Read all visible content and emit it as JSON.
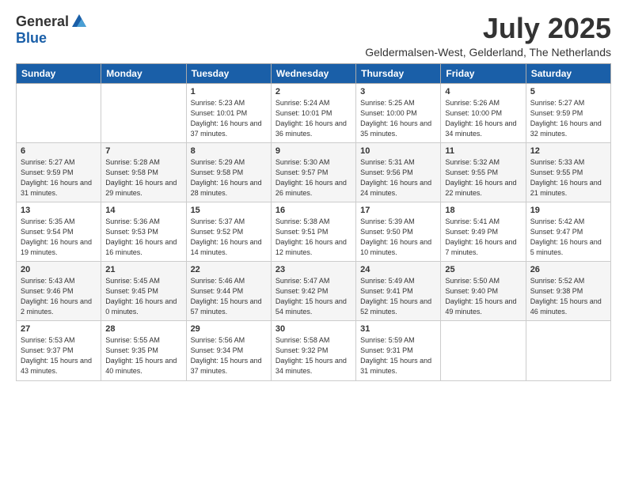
{
  "logo": {
    "general": "General",
    "blue": "Blue"
  },
  "title": "July 2025",
  "subtitle": "Geldermalsen-West, Gelderland, The Netherlands",
  "weekdays": [
    "Sunday",
    "Monday",
    "Tuesday",
    "Wednesday",
    "Thursday",
    "Friday",
    "Saturday"
  ],
  "weeks": [
    [
      {
        "day": "",
        "info": ""
      },
      {
        "day": "",
        "info": ""
      },
      {
        "day": "1",
        "info": "Sunrise: 5:23 AM\nSunset: 10:01 PM\nDaylight: 16 hours\nand 37 minutes."
      },
      {
        "day": "2",
        "info": "Sunrise: 5:24 AM\nSunset: 10:01 PM\nDaylight: 16 hours\nand 36 minutes."
      },
      {
        "day": "3",
        "info": "Sunrise: 5:25 AM\nSunset: 10:00 PM\nDaylight: 16 hours\nand 35 minutes."
      },
      {
        "day": "4",
        "info": "Sunrise: 5:26 AM\nSunset: 10:00 PM\nDaylight: 16 hours\nand 34 minutes."
      },
      {
        "day": "5",
        "info": "Sunrise: 5:27 AM\nSunset: 9:59 PM\nDaylight: 16 hours\nand 32 minutes."
      }
    ],
    [
      {
        "day": "6",
        "info": "Sunrise: 5:27 AM\nSunset: 9:59 PM\nDaylight: 16 hours\nand 31 minutes."
      },
      {
        "day": "7",
        "info": "Sunrise: 5:28 AM\nSunset: 9:58 PM\nDaylight: 16 hours\nand 29 minutes."
      },
      {
        "day": "8",
        "info": "Sunrise: 5:29 AM\nSunset: 9:58 PM\nDaylight: 16 hours\nand 28 minutes."
      },
      {
        "day": "9",
        "info": "Sunrise: 5:30 AM\nSunset: 9:57 PM\nDaylight: 16 hours\nand 26 minutes."
      },
      {
        "day": "10",
        "info": "Sunrise: 5:31 AM\nSunset: 9:56 PM\nDaylight: 16 hours\nand 24 minutes."
      },
      {
        "day": "11",
        "info": "Sunrise: 5:32 AM\nSunset: 9:55 PM\nDaylight: 16 hours\nand 22 minutes."
      },
      {
        "day": "12",
        "info": "Sunrise: 5:33 AM\nSunset: 9:55 PM\nDaylight: 16 hours\nand 21 minutes."
      }
    ],
    [
      {
        "day": "13",
        "info": "Sunrise: 5:35 AM\nSunset: 9:54 PM\nDaylight: 16 hours\nand 19 minutes."
      },
      {
        "day": "14",
        "info": "Sunrise: 5:36 AM\nSunset: 9:53 PM\nDaylight: 16 hours\nand 16 minutes."
      },
      {
        "day": "15",
        "info": "Sunrise: 5:37 AM\nSunset: 9:52 PM\nDaylight: 16 hours\nand 14 minutes."
      },
      {
        "day": "16",
        "info": "Sunrise: 5:38 AM\nSunset: 9:51 PM\nDaylight: 16 hours\nand 12 minutes."
      },
      {
        "day": "17",
        "info": "Sunrise: 5:39 AM\nSunset: 9:50 PM\nDaylight: 16 hours\nand 10 minutes."
      },
      {
        "day": "18",
        "info": "Sunrise: 5:41 AM\nSunset: 9:49 PM\nDaylight: 16 hours\nand 7 minutes."
      },
      {
        "day": "19",
        "info": "Sunrise: 5:42 AM\nSunset: 9:47 PM\nDaylight: 16 hours\nand 5 minutes."
      }
    ],
    [
      {
        "day": "20",
        "info": "Sunrise: 5:43 AM\nSunset: 9:46 PM\nDaylight: 16 hours\nand 2 minutes."
      },
      {
        "day": "21",
        "info": "Sunrise: 5:45 AM\nSunset: 9:45 PM\nDaylight: 16 hours\nand 0 minutes."
      },
      {
        "day": "22",
        "info": "Sunrise: 5:46 AM\nSunset: 9:44 PM\nDaylight: 15 hours\nand 57 minutes."
      },
      {
        "day": "23",
        "info": "Sunrise: 5:47 AM\nSunset: 9:42 PM\nDaylight: 15 hours\nand 54 minutes."
      },
      {
        "day": "24",
        "info": "Sunrise: 5:49 AM\nSunset: 9:41 PM\nDaylight: 15 hours\nand 52 minutes."
      },
      {
        "day": "25",
        "info": "Sunrise: 5:50 AM\nSunset: 9:40 PM\nDaylight: 15 hours\nand 49 minutes."
      },
      {
        "day": "26",
        "info": "Sunrise: 5:52 AM\nSunset: 9:38 PM\nDaylight: 15 hours\nand 46 minutes."
      }
    ],
    [
      {
        "day": "27",
        "info": "Sunrise: 5:53 AM\nSunset: 9:37 PM\nDaylight: 15 hours\nand 43 minutes."
      },
      {
        "day": "28",
        "info": "Sunrise: 5:55 AM\nSunset: 9:35 PM\nDaylight: 15 hours\nand 40 minutes."
      },
      {
        "day": "29",
        "info": "Sunrise: 5:56 AM\nSunset: 9:34 PM\nDaylight: 15 hours\nand 37 minutes."
      },
      {
        "day": "30",
        "info": "Sunrise: 5:58 AM\nSunset: 9:32 PM\nDaylight: 15 hours\nand 34 minutes."
      },
      {
        "day": "31",
        "info": "Sunrise: 5:59 AM\nSunset: 9:31 PM\nDaylight: 15 hours\nand 31 minutes."
      },
      {
        "day": "",
        "info": ""
      },
      {
        "day": "",
        "info": ""
      }
    ]
  ]
}
